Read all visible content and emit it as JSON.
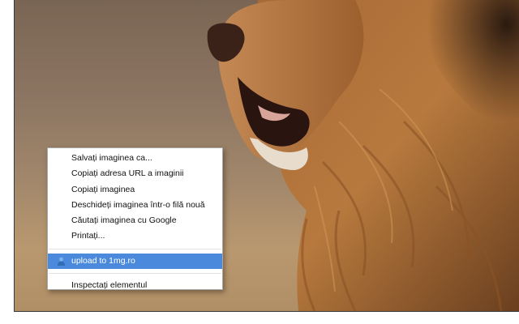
{
  "context_menu": {
    "group1": [
      "Salvați imaginea ca...",
      "Copiați adresa URL a imaginii",
      "Copiați imaginea",
      "Deschideți imaginea într-o filă nouă",
      "Căutați imaginea cu Google",
      "Printați..."
    ],
    "extension_item": {
      "label": "upload to 1mg.ro",
      "icon": "person-upload-icon",
      "highlighted": true
    },
    "inspect": "Inspectați elementul"
  },
  "colors": {
    "highlight": "#4a89dc",
    "menu_bg": "#ffffff",
    "menu_border": "#a8a8a8"
  }
}
